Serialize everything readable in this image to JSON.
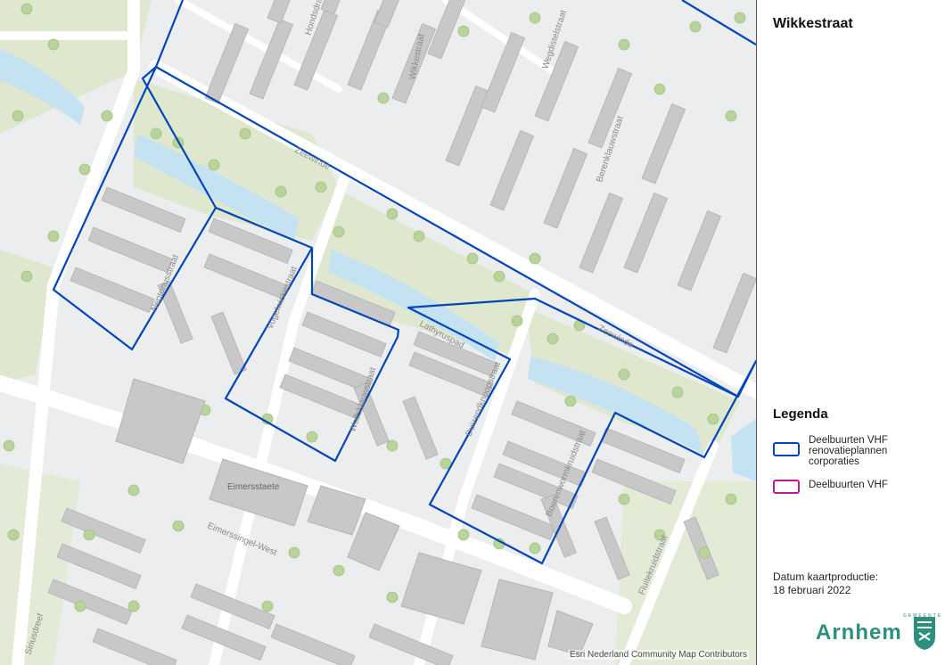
{
  "map": {
    "title": "Wikkestraat",
    "attribution": "Esri Nederland Community Map Contributors",
    "streets": [
      "Wikkestraat",
      "Wegdistelstraat",
      "Berenklauwstraat",
      "Zeewinde",
      "Lathyruspad",
      "Wolfsklauwstraat",
      "Eimerssingel-West",
      "Fluitekruidstraat",
      "Siriusdreef",
      "Hondsdraf",
      "Vogelwickestraat",
      "Duizendknoopstraat",
      "Boerenwormkruidstraat",
      "Kalfsvoetstraat",
      "Neptunusstraat"
    ],
    "poi": [
      "Eimersstaete"
    ],
    "colors": {
      "background": "#ecedee",
      "park": "#dfe8cf",
      "water": "#c5e2f2",
      "building": "#c8c8c8",
      "road": "#ffffff",
      "tree": "#b8d49a",
      "boundary": "#0046b8"
    }
  },
  "legend": {
    "title": "Legenda",
    "items": [
      {
        "label": "Deelbuurten VHF renovatieplannen corporaties",
        "color": "#0046b8"
      },
      {
        "label": "Deelbuurten VHF",
        "color": "#c0179b"
      }
    ]
  },
  "production": {
    "label": "Datum kaartproductie:",
    "date": "18 februari 2022"
  },
  "logo": {
    "small": "GEMEENTE",
    "name": "Arnhem"
  }
}
